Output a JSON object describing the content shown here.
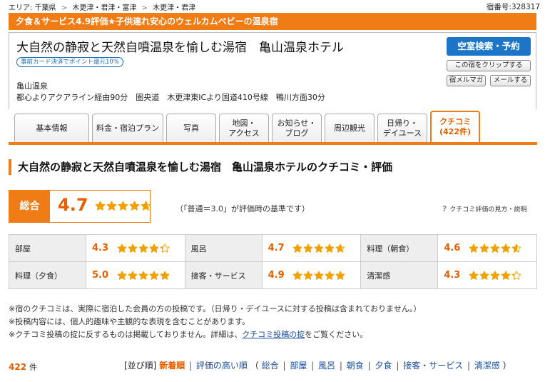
{
  "breadcrumb": {
    "prefix": "エリア:",
    "items": [
      "千葉県",
      "木更津・君津・富津",
      "木更津・君津"
    ],
    "separator": ">"
  },
  "inn_number": "宿番号:328317",
  "banner": "夕食＆サービス4.9評価★子供連れ安心のウェルカムベビーの温泉宿",
  "hotel": {
    "title": "大自然の静寂と天然自噴温泉を愉しむ湯宿　亀山温泉ホテル",
    "card_badge": "事前カード決済でポイント還元10%",
    "area": "亀山温泉",
    "access": "都心よりアクアライン経由90分　圏央道　木更津東ICより国道410号線　鴨川方面30分"
  },
  "actions": {
    "search": "空室検索・予約",
    "clip": "この宿をクリップする",
    "mail_inn": "宿メルマガ",
    "mail_send": "メールする"
  },
  "tabs": [
    {
      "label": "基本情報"
    },
    {
      "label": "料金・宿泊プラン"
    },
    {
      "label": "写真"
    },
    {
      "label": "地図・\nアクセス"
    },
    {
      "label": "お知らせ・\nブログ"
    },
    {
      "label": "周辺観光"
    },
    {
      "label": "日帰り・\nデイユース"
    },
    {
      "label": "クチコミ\n(422件)"
    }
  ],
  "active_tab": 7,
  "section_title": "大自然の静寂と天然自噴温泉を愉しむ湯宿　亀山温泉ホテルのクチコミ・評価",
  "overall": {
    "label": "総合",
    "score": "4.7",
    "stars": 4.7
  },
  "basis_note": "（「普通＝3.0」が評価時の基準です）",
  "help_link": "クチコミ評価の見方・説明",
  "categories": [
    [
      {
        "label": "部屋",
        "score": "4.3",
        "stars": 4.3
      },
      {
        "label": "風呂",
        "score": "4.7",
        "stars": 4.7
      },
      {
        "label": "料理（朝食）",
        "score": "4.6",
        "stars": 4.6
      }
    ],
    [
      {
        "label": "料理（夕食）",
        "score": "5.0",
        "stars": 5.0
      },
      {
        "label": "接客・サービス",
        "score": "4.9",
        "stars": 4.9
      },
      {
        "label": "清潔感",
        "score": "4.3",
        "stars": 4.3
      }
    ]
  ],
  "notes": {
    "line1": "※宿のクチコミは、実際に宿泊した会員の方の投稿です。（日帰り・デイユースに対する投稿は含まれておりません。）",
    "line2": "※投稿内容には、個人的趣味や主観的な表現を含むことがあります。",
    "line3_pre": "※クチコミ投稿の掟に反するものは掲載しておりません。詳細は、",
    "line3_link": "クチコミ投稿の掟",
    "line3_post": "をご覧ください。"
  },
  "review_count": {
    "number": "422",
    "unit": "件"
  },
  "sort": {
    "label": "[並び順]",
    "current": "新着順",
    "options": [
      "評価の高い順",
      "総合",
      "部屋",
      "風呂",
      "朝食",
      "夕食",
      "接客・サービス",
      "清潔感"
    ],
    "open_paren": "（",
    "close_paren": "）"
  },
  "colors": {
    "accent": "#f07c16",
    "score": "#e35f00",
    "link": "#1a4fa0",
    "button": "#1d75c7",
    "star": "#f0a000"
  }
}
